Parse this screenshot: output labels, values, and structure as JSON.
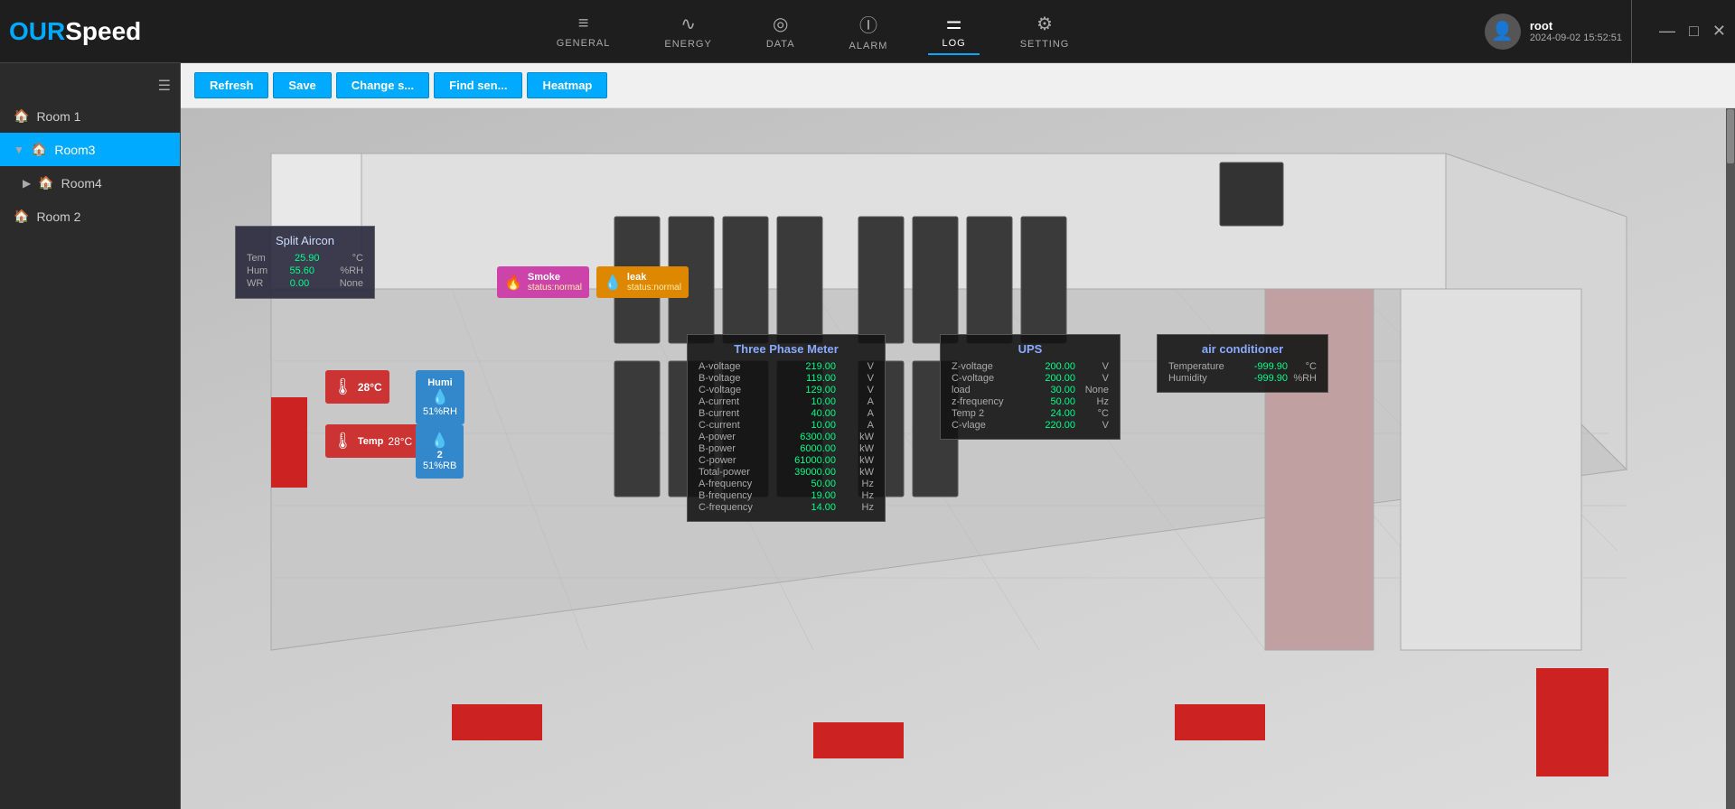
{
  "app": {
    "logo_our": "OUR",
    "logo_speed": "Speed"
  },
  "nav": {
    "items": [
      {
        "id": "general",
        "label": "GENERAL",
        "icon": "≡"
      },
      {
        "id": "energy",
        "label": "ENERGY",
        "icon": "∿"
      },
      {
        "id": "data",
        "label": "DATA",
        "icon": "⊙"
      },
      {
        "id": "alarm",
        "label": "ALARM",
        "icon": "ⓘ"
      },
      {
        "id": "log",
        "label": "LOG",
        "icon": "≡≡",
        "active": true
      },
      {
        "id": "setting",
        "label": "SETTING",
        "icon": "⚙"
      }
    ]
  },
  "user": {
    "name": "root",
    "datetime": "2024-09-02 15:52:51",
    "avatar_icon": "👤"
  },
  "window_controls": {
    "minimize": "—",
    "maximize": "□",
    "close": "✕"
  },
  "sidebar": {
    "toggle_icon": "☰",
    "items": [
      {
        "id": "room1",
        "label": "Room 1",
        "active": false,
        "expanded": false
      },
      {
        "id": "room3",
        "label": "Room3",
        "active": true,
        "expanded": true
      },
      {
        "id": "room4",
        "label": "Room4",
        "active": false,
        "expanded": false
      },
      {
        "id": "room2",
        "label": "Room 2",
        "active": false,
        "expanded": false
      }
    ]
  },
  "toolbar": {
    "refresh_label": "Refresh",
    "save_label": "Save",
    "change_s_label": "Change s...",
    "find_sen_label": "Find sen...",
    "heatmap_label": "Heatmap"
  },
  "split_aircon": {
    "title": "Split Aircon",
    "rows": [
      {
        "label": "Tem",
        "value": "25.90",
        "unit": "°C"
      },
      {
        "label": "Hum",
        "value": "55.60",
        "unit": "%RH"
      },
      {
        "label": "WR",
        "value": "0.00",
        "unit": "None"
      }
    ]
  },
  "smoke_sensor": {
    "name": "Smoke",
    "status": "status:normal",
    "icon": "🔥"
  },
  "leak_sensor": {
    "name": "leak",
    "status": "status:normal",
    "icon": "💧"
  },
  "temp1": {
    "value": "28°C",
    "icon": "🌡"
  },
  "humi1": {
    "name": "Humi",
    "value": "51%RH",
    "icon": "💧"
  },
  "temp2": {
    "name": "Temp",
    "value": "28°C",
    "icon": "🌡"
  },
  "humi2": {
    "num": "2",
    "value": "51%RB",
    "icon": "💧"
  },
  "three_phase": {
    "title": "Three Phase Meter",
    "rows": [
      {
        "label": "A-voltage",
        "value": "219.00",
        "unit": "V"
      },
      {
        "label": "B-voltage",
        "value": "119.00",
        "unit": "V"
      },
      {
        "label": "C-voltage",
        "value": "129.00",
        "unit": "V"
      },
      {
        "label": "A-current",
        "value": "10.00",
        "unit": "A"
      },
      {
        "label": "B-current",
        "value": "40.00",
        "unit": "A"
      },
      {
        "label": "C-current",
        "value": "10.00",
        "unit": "A"
      },
      {
        "label": "A-power",
        "value": "6300.00",
        "unit": "kW"
      },
      {
        "label": "B-power",
        "value": "6000.00",
        "unit": "kW"
      },
      {
        "label": "C-power",
        "value": "61000.00",
        "unit": "kW"
      },
      {
        "label": "Total-power",
        "value": "39000.00",
        "unit": "kW"
      },
      {
        "label": "A-frequency",
        "value": "50.00",
        "unit": "Hz"
      },
      {
        "label": "B-frequency",
        "value": "19.00",
        "unit": "Hz"
      },
      {
        "label": "C-frequency",
        "value": "14.00",
        "unit": "Hz"
      }
    ]
  },
  "ups": {
    "title": "UPS",
    "rows": [
      {
        "label": "Z-voltage",
        "value": "200.00",
        "unit": "V"
      },
      {
        "label": "C-voltage",
        "value": "200.00",
        "unit": "V"
      },
      {
        "label": "load",
        "value": "30.00",
        "unit": "None"
      },
      {
        "label": "z-frequency",
        "value": "50.00",
        "unit": "Hz"
      },
      {
        "label": "Temp 2",
        "value": "24.00",
        "unit": "°C"
      },
      {
        "label": "C-vlage",
        "value": "220.00",
        "unit": "V"
      }
    ]
  },
  "air_conditioner": {
    "title": "air conditioner",
    "rows": [
      {
        "label": "Temperature",
        "value": "-999.90",
        "unit": "°C"
      },
      {
        "label": "Humidity",
        "value": "-999.90",
        "unit": "%RH"
      }
    ]
  }
}
